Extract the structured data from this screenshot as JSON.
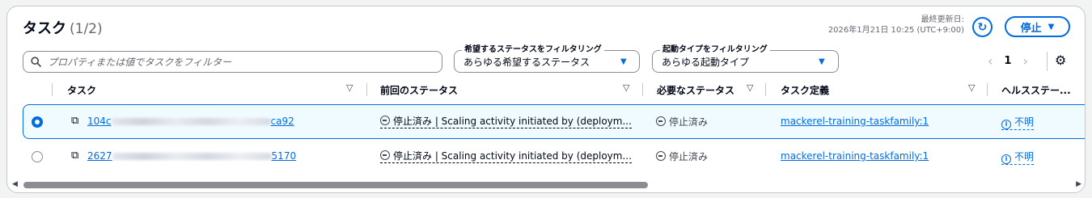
{
  "header": {
    "title": "タスク",
    "count": "(1/2)",
    "updated_label": "最終更新日:",
    "updated_value": "2026年1月21日 10:25 (UTC+9:00)",
    "stop_label": "停止"
  },
  "search": {
    "placeholder": "プロパティまたは値でタスクをフィルター"
  },
  "filters": {
    "desired_status": {
      "label": "希望するステータスをフィルタリング",
      "value": "あらゆる希望するステータス"
    },
    "launch_type": {
      "label": "起動タイプをフィルタリング",
      "value": "あらゆる起動タイプ"
    }
  },
  "pagination": {
    "current_page": "1"
  },
  "columns": [
    "タスク",
    "前回のステータス",
    "必要なステータス",
    "タスク定義",
    "ヘルスステー..."
  ],
  "rows": [
    {
      "selected": true,
      "task_prefix": "104c",
      "task_suffix": "ca92",
      "last_status": "停止済み | Scaling activity initiated by (deploym...",
      "desired_status": "停止済み",
      "task_definition": "mackerel-training-taskfamily:1",
      "health": "不明"
    },
    {
      "selected": false,
      "task_prefix": "2627",
      "task_suffix": "5170",
      "last_status": "停止済み | Scaling activity initiated by (deploym...",
      "desired_status": "停止済み",
      "task_definition": "mackerel-training-taskfamily:1",
      "health": "不明"
    }
  ],
  "icons": {
    "search": "search-icon",
    "refresh": "refresh-icon",
    "settings": "gear-icon",
    "copy": "copy-icon",
    "stopped": "minus-circle-icon",
    "info": "info-icon"
  },
  "colors": {
    "accent": "#006ce0",
    "selected_row": "#f0fbff"
  }
}
